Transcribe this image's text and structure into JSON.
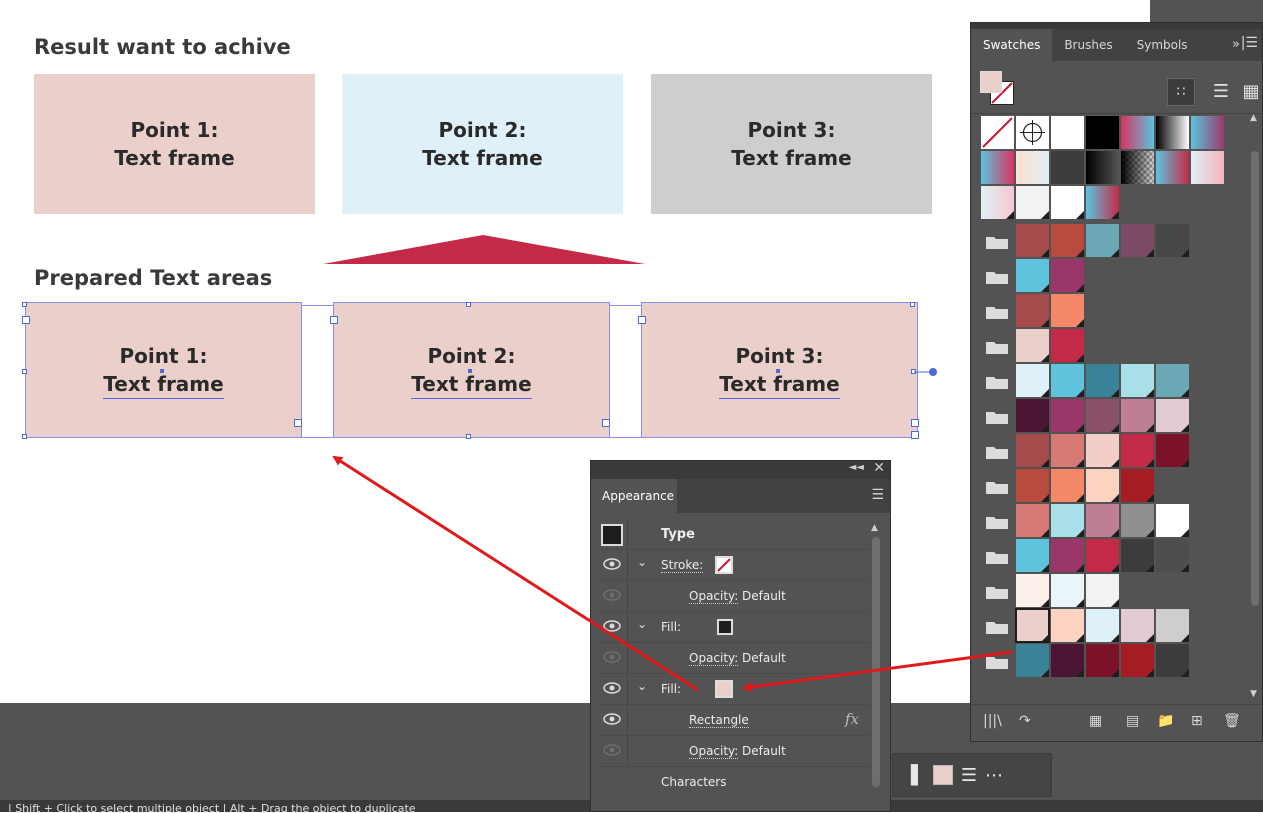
{
  "canvas": {
    "result_heading": "Result want to achive",
    "prepared_heading": "Prepared Text areas",
    "result_boxes": [
      {
        "line1": "Point 1:",
        "line2": "Text frame",
        "color": "#ebcfcb"
      },
      {
        "line1": "Point 2:",
        "line2": "Text frame",
        "color": "#e0f0f8"
      },
      {
        "line1": "Point 3:",
        "line2": "Text frame",
        "color": "#cfcdce"
      }
    ],
    "prepared_boxes": [
      {
        "line1": "Point 1:",
        "line2": "Text frame"
      },
      {
        "line1": "Point 2:",
        "line2": "Text frame"
      },
      {
        "line1": "Point 3:",
        "line2": "Text frame"
      }
    ],
    "arrow_color": "#c42a48",
    "annotation_arrow_color": "#e0191b"
  },
  "swatches_panel": {
    "tabs": [
      "Swatches",
      "Brushes",
      "Symbols"
    ],
    "active_tab": "Swatches",
    "more_icon": "double-chevron-right-icon",
    "menu_icon": "panel-menu-icon",
    "bottom_icons": [
      "swatch-libraries-icon",
      "place-swatches-icon",
      "show-kinds-icon",
      "swatch-options-icon",
      "new-color-group-icon",
      "new-swatch-icon",
      "delete-swatch-icon"
    ]
  },
  "appearance_panel": {
    "title": "Appearance",
    "rows": {
      "type_label": "Type",
      "stroke_label": "Stroke:",
      "opacity_label": "Opacity:",
      "opacity_value": "Default",
      "fill_label": "Fill:",
      "rectangle_label": "Rectangle",
      "fx_label": "fx",
      "characters_label": "Characters"
    },
    "fill_black": "#1e1e1e",
    "fill_pink": "#ebcfcb"
  },
  "status_bar": {
    "text": "| Shift + Click to select multiple object | Alt + Drag the object to duplicate"
  }
}
